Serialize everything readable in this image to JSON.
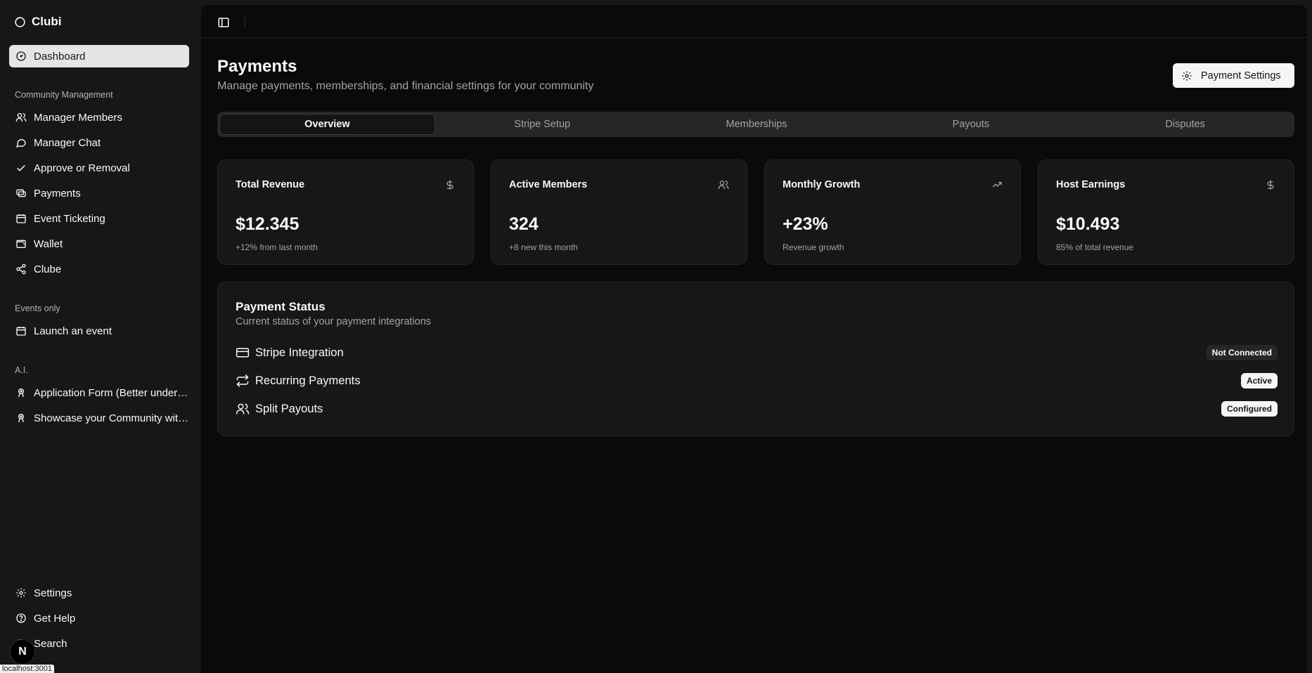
{
  "app": {
    "name": "Clubi"
  },
  "sidebar": {
    "dashboard": {
      "label": "Dashboard",
      "icon": "gauge-icon"
    },
    "groups": [
      {
        "label": "Community Management"
      },
      {
        "label": "Events only"
      },
      {
        "label": "A.I."
      }
    ],
    "community_items": [
      {
        "label": "Manager Members",
        "icon": "users-icon"
      },
      {
        "label": "Manager Chat",
        "icon": "chat-icon"
      },
      {
        "label": "Approve or Removal",
        "icon": "check-icon"
      },
      {
        "label": "Payments",
        "icon": "payments-icon"
      },
      {
        "label": "Event Ticketing",
        "icon": "calendar-icon"
      },
      {
        "label": "Wallet",
        "icon": "wallet-icon"
      },
      {
        "label": "Clube",
        "icon": "share-icon"
      }
    ],
    "events_items": [
      {
        "label": "Launch an event",
        "icon": "calendar-icon"
      }
    ],
    "ai_items": [
      {
        "label": "Application Form (Better understand your community)",
        "icon": "bot-icon"
      },
      {
        "label": "Showcase your Community with AI",
        "icon": "bot-icon"
      }
    ],
    "footer_items": [
      {
        "label": "Settings",
        "icon": "gear-icon"
      },
      {
        "label": "Get Help",
        "icon": "help-icon"
      },
      {
        "label": "Search",
        "icon": "search-icon"
      }
    ]
  },
  "dev_badge": {
    "letter": "N"
  },
  "status_bar": {
    "url": "localhost:3001"
  },
  "page": {
    "title": "Payments",
    "subtitle": "Manage payments, memberships, and financial settings for your community",
    "settings_button": "Payment Settings"
  },
  "tabs": [
    {
      "label": "Overview",
      "active": true
    },
    {
      "label": "Stripe Setup",
      "active": false
    },
    {
      "label": "Memberships",
      "active": false
    },
    {
      "label": "Payouts",
      "active": false
    },
    {
      "label": "Disputes",
      "active": false
    }
  ],
  "stats": [
    {
      "title": "Total Revenue",
      "value": "$12.345",
      "sub": "+12% from last month",
      "icon": "dollar-icon"
    },
    {
      "title": "Active Members",
      "value": "324",
      "sub": "+8 new this month",
      "icon": "users-icon"
    },
    {
      "title": "Monthly Growth",
      "value": "+23%",
      "sub": "Revenue growth",
      "icon": "trending-up-icon"
    },
    {
      "title": "Host Earnings",
      "value": "$10.493",
      "sub": "85% of total revenue",
      "icon": "dollar-icon"
    }
  ],
  "payment_status": {
    "title": "Payment Status",
    "subtitle": "Current status of your payment integrations",
    "rows": [
      {
        "label": "Stripe Integration",
        "badge": "Not Connected",
        "icon": "credit-card-icon"
      },
      {
        "label": "Recurring Payments",
        "badge": "Active",
        "icon": "repeat-icon"
      },
      {
        "label": "Split Payouts",
        "badge": "Configured",
        "icon": "users-icon"
      }
    ]
  },
  "colors": {
    "sidebar_bg": "#171717",
    "main_bg": "#0a0a0a",
    "card_bg": "#171717",
    "border": "#262626",
    "text": "#fafafa",
    "muted": "#a3a3a3",
    "active_nav": "#e5e5e5"
  }
}
